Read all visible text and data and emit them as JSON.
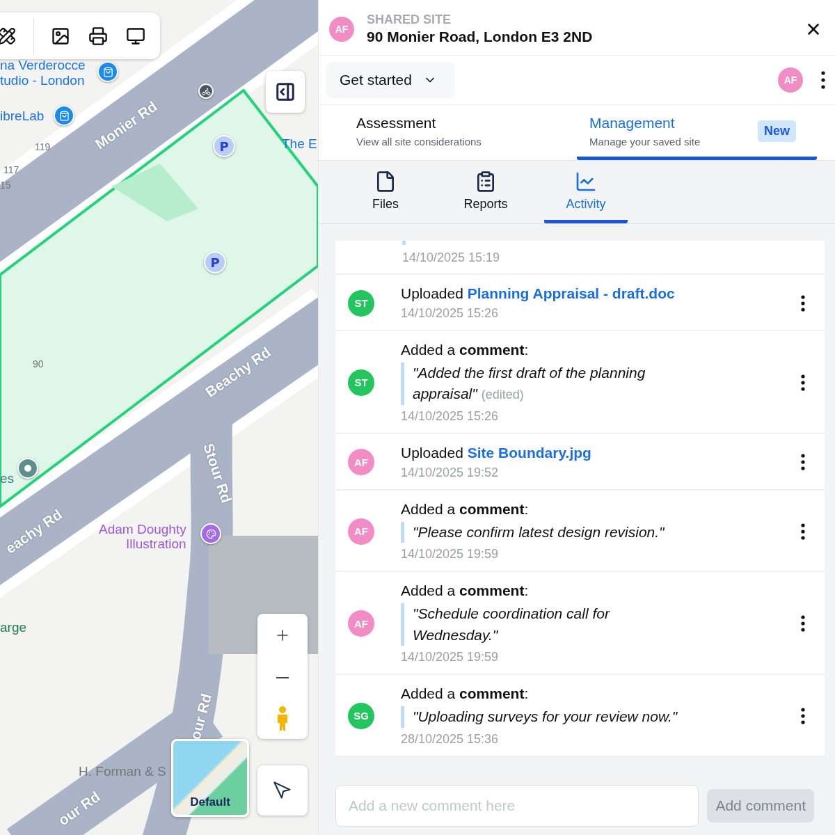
{
  "map": {
    "labels": [
      {
        "kind": "place",
        "text": "na Verderocce",
        "color": "#1a73e8"
      },
      {
        "kind": "place",
        "text": "tudio - London",
        "color": "#1a73e8"
      },
      {
        "kind": "place",
        "text": "ibreLab",
        "color": "#1a73e8"
      },
      {
        "kind": "number",
        "text": "119"
      },
      {
        "kind": "number",
        "text": "117"
      },
      {
        "kind": "number",
        "text": "15"
      },
      {
        "kind": "road",
        "text": "Monier Rd"
      },
      {
        "kind": "place",
        "text": "The E",
        "color": "#1a73e8"
      },
      {
        "kind": "number",
        "text": "90"
      },
      {
        "kind": "road",
        "text": "Beachy Rd"
      },
      {
        "kind": "place",
        "text": "es",
        "color": "#3d7a78"
      },
      {
        "kind": "road",
        "text": "eachy Rd"
      },
      {
        "kind": "road",
        "text": "Stour Rd"
      },
      {
        "kind": "place",
        "text": "Adam Doughty",
        "color": "#9b59d8"
      },
      {
        "kind": "place",
        "text": "Illustration",
        "color": "#9b59d8"
      },
      {
        "kind": "place",
        "text": "arge",
        "color": "#1e7a57"
      },
      {
        "kind": "road",
        "text": "our Rd"
      },
      {
        "kind": "place",
        "text": "H. Forman & S",
        "color": "#70757a"
      },
      {
        "kind": "road",
        "text": "our Rd"
      }
    ],
    "parking_pins": [
      {
        "text": "P"
      },
      {
        "text": "P"
      }
    ],
    "basemap": {
      "label": "Default"
    }
  },
  "panel": {
    "header": {
      "avatar": {
        "initials": "AF",
        "color": "#f28cc4"
      },
      "eyebrow": "SHARED SITE",
      "title": "90 Monier Road, London E3 2ND"
    },
    "menu_button": "Get started",
    "user_avatar": {
      "initials": "AF",
      "color": "#f28cc4"
    },
    "section_tabs": [
      {
        "title": "Assessment",
        "subtitle": "View all site considerations",
        "selected": false
      },
      {
        "title": "Management",
        "subtitle": "Manage your saved site",
        "badge": "New",
        "selected": true
      }
    ],
    "view_tabs": [
      {
        "kind": "files",
        "label": "Files",
        "selected": false
      },
      {
        "kind": "reports",
        "label": "Reports",
        "selected": false
      },
      {
        "kind": "activity",
        "label": "Activity",
        "selected": true
      }
    ],
    "activity": [
      {
        "kind": "partial",
        "time": "14/10/2025 15:19"
      },
      {
        "kind": "upload",
        "avatar": {
          "initials": "ST",
          "color": "#22c55e"
        },
        "action": "Uploaded",
        "file": "Planning Appraisal - draft.doc",
        "time": "14/10/2025 15:26"
      },
      {
        "kind": "comment",
        "avatar": {
          "initials": "ST",
          "color": "#22c55e"
        },
        "heading": "Added a **comment**:",
        "quote": "\"Added the first draft of the planning appraisal\"",
        "edited": "(edited)",
        "time": "14/10/2025 15:26"
      },
      {
        "kind": "upload",
        "avatar": {
          "initials": "AF",
          "color": "#f28cc4"
        },
        "action": "Uploaded",
        "file": "Site Boundary.jpg",
        "time": "14/10/2025 19:52"
      },
      {
        "kind": "comment",
        "avatar": {
          "initials": "AF",
          "color": "#f28cc4"
        },
        "heading": "Added a **comment**:",
        "quote": "\"Please confirm latest design revision.\"",
        "time": "14/10/2025 19:59"
      },
      {
        "kind": "comment",
        "avatar": {
          "initials": "AF",
          "color": "#f28cc4"
        },
        "heading": "Added a **comment**:",
        "quote": "\"Schedule coordination call for Wednesday.\"",
        "time": "14/10/2025 19:59"
      },
      {
        "kind": "comment",
        "avatar": {
          "initials": "SG",
          "color": "#22c55e"
        },
        "heading": "Added a **comment**:",
        "quote": "\"Uploading surveys for your review now.\"",
        "time": "28/10/2025 15:36"
      }
    ],
    "comment_box": {
      "placeholder": "Add a new comment here"
    },
    "submit": {
      "label": "Add comment",
      "disabled": true
    }
  }
}
